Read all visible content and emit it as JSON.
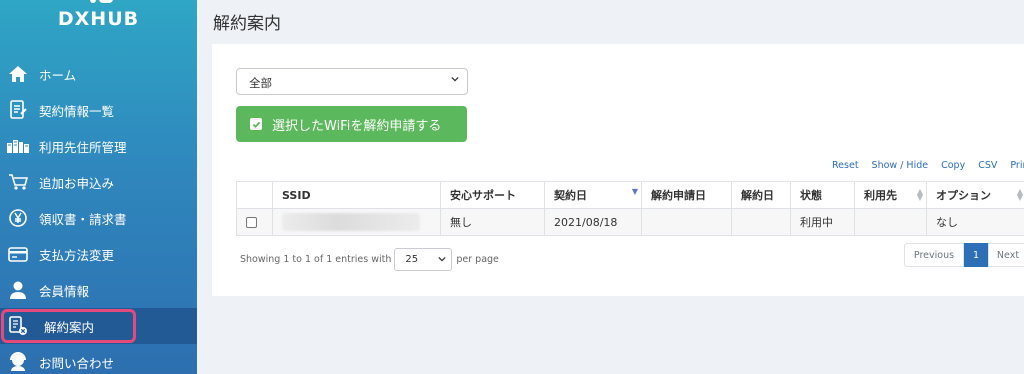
{
  "brand": "DXHUB",
  "sidebar": {
    "items": [
      {
        "label": "ホーム",
        "icon": "home-icon"
      },
      {
        "label": "契約情報一覧",
        "icon": "contract-list-icon"
      },
      {
        "label": "利用先住所管理",
        "icon": "address-icon"
      },
      {
        "label": "追加お申込み",
        "icon": "cart-icon"
      },
      {
        "label": "領収書・請求書",
        "icon": "yen-icon"
      },
      {
        "label": "支払方法変更",
        "icon": "card-icon"
      },
      {
        "label": "会員情報",
        "icon": "user-icon"
      },
      {
        "label": "解約案内",
        "icon": "cancel-doc-icon",
        "active": true
      },
      {
        "label": "お問い合わせ",
        "icon": "support-icon"
      }
    ]
  },
  "main": {
    "title": "解約案内",
    "filter": {
      "selected": "全部"
    },
    "apply_button": "選択したWiFiを解約申請する",
    "toolbar": [
      "Reset",
      "Show / Hide",
      "Copy",
      "CSV",
      "Print"
    ],
    "table": {
      "columns": [
        "SSID",
        "安心サポート",
        "契約日",
        "解約申請日",
        "解約日",
        "状態",
        "利用先",
        "オプション"
      ],
      "rows": [
        {
          "ssid": "",
          "support": "無し",
          "contract_date": "2021/08/18",
          "cancel_request_date": "",
          "cancel_date": "",
          "status": "利用中",
          "location": "",
          "option": "なし"
        }
      ]
    },
    "footer": {
      "showing": "Showing 1 to 1 of 1 entries with",
      "per_page_value": "25",
      "per_page_label": "per page"
    },
    "pagination": {
      "prev": "Previous",
      "current": "1",
      "next": "Next"
    }
  },
  "colors": {
    "sidebar_top": "#2fa6c5",
    "sidebar_bottom": "#2d6fb0",
    "active_item": "#225a96",
    "highlight": "#e44a7b",
    "apply_button": "#5cb85c",
    "link": "#2b6fb6"
  }
}
